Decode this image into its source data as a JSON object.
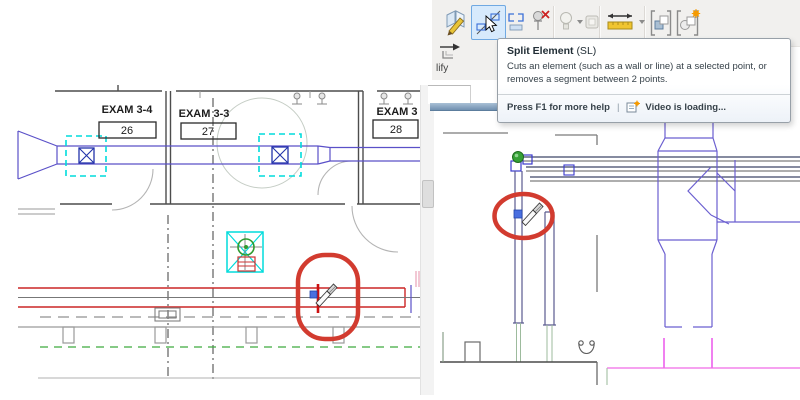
{
  "ribbon": {
    "panel_label_partial": "lify",
    "active_tool": "Split Element",
    "icons": [
      "split-face-icon",
      "split-element-icon",
      "split-with-gap-icon",
      "unpin-icon",
      "lightbulb-icon",
      "dropdown-caret-icon",
      "cube-icon",
      "measure-icon",
      "create-group-icon",
      "group-options-icon",
      "offset-icon"
    ]
  },
  "tooltip": {
    "title": "Split Element",
    "shortcut": "(SL)",
    "description": "Cuts an element (such as a wall or line) at a selected point, or removes a segment between 2 points.",
    "help_text": "Press F1 for more help",
    "divider": "|",
    "video_icon": "video-loading-icon",
    "video_status": "Video is loading..."
  },
  "plan_view": {
    "rooms": [
      {
        "name": "EXAM 3-4",
        "number": "26"
      },
      {
        "name": "EXAM 3-3",
        "number": "27"
      },
      {
        "name": "EXAM 3",
        "number": "28"
      }
    ]
  },
  "colors": {
    "markup_red": "#d23b2f",
    "selection_cyan": "#00dcdc",
    "duct_purple": "#5a50c8",
    "duct_red": "#cc2626",
    "pipe_magenta": "#e83ce8",
    "insulation_green": "#3faa3f",
    "hover_highlight_blue": "#d7eafc",
    "view_bar_blue": "#7e9dbd"
  }
}
